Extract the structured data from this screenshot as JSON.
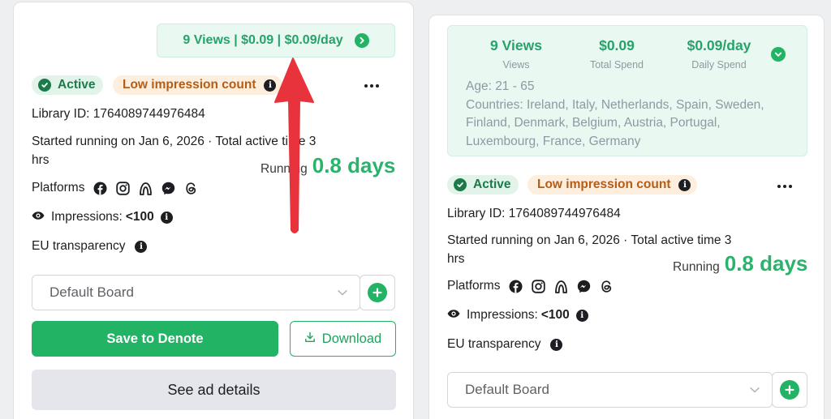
{
  "cards": [
    {
      "stats": {
        "summary": "9 Views | $0.09 | $0.09/day"
      },
      "badges": {
        "active": "Active",
        "impression": "Low impression count"
      },
      "library_id": "Library ID: 1764089744976484",
      "started": {
        "line1": "Started running on Jan 6, 2026 · Total active time 3",
        "line2": "hrs"
      },
      "running": {
        "label": "Running",
        "value": "0.8 days"
      },
      "platforms_label": "Platforms",
      "impressions": {
        "label": "Impressions:",
        "value": "<100"
      },
      "eu_label": "EU transparency",
      "board": {
        "selected": "Default Board"
      },
      "buttons": {
        "save": "Save to Denote",
        "download": "Download",
        "details": "See ad details"
      }
    },
    {
      "stats": {
        "items": [
          {
            "value": "9 Views",
            "label": "Views"
          },
          {
            "value": "$0.09",
            "label": "Total Spend"
          },
          {
            "value": "$0.09/day",
            "label": "Daily Spend"
          }
        ],
        "age": "Age: 21 - 65",
        "countries_lines": [
          "Countries: Ireland, Italy, Netherlands, Spain, Sweden,",
          "Finland, Denmark, Belgium, Austria, Portugal,",
          "Luxembourg, France, Germany"
        ]
      },
      "badges": {
        "active": "Active",
        "impression": "Low impression count"
      },
      "library_id": "Library ID: 1764089744976484",
      "started": {
        "line1": "Started running on Jan 6, 2026 · Total active time 3",
        "line2": "hrs"
      },
      "running": {
        "label": "Running",
        "value": "0.8 days"
      },
      "platforms_label": "Platforms",
      "impressions": {
        "label": "Impressions:",
        "value": "<100"
      },
      "eu_label": "EU transparency",
      "board": {
        "selected": "Default Board"
      }
    }
  ],
  "platform_icons": [
    "facebook-icon",
    "instagram-icon",
    "audience-network-icon",
    "messenger-icon",
    "threads-icon"
  ],
  "colors": {
    "accent_green": "#22b365",
    "stat_green": "#25a36a",
    "active_badge_bg": "#e2f4ea",
    "low_badge_bg": "#fdeedd",
    "low_badge_text": "#b35d17",
    "arrow_red": "#e8323c"
  }
}
